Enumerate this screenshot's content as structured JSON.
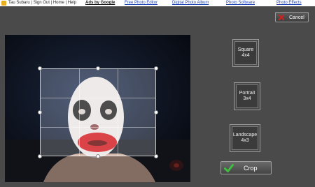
{
  "topbar": {
    "user_links": "Tau Subaru | Sign Out | Home | Help",
    "ads_label": "Ads by Google",
    "links": [
      "Free Photo Editor",
      "Digital Photo Album",
      "Photo Software",
      "Photo Effects"
    ]
  },
  "dialog": {
    "cancel_label": "Cancel",
    "ratios": [
      {
        "name": "Square",
        "dims": "4x4"
      },
      {
        "name": "Portrait",
        "dims": "3x4"
      },
      {
        "name": "Landscape",
        "dims": "4x3"
      }
    ],
    "crop_label": "Crop"
  },
  "colors": {
    "panel_bg": "#4a4a4a",
    "link": "#1a3fb0",
    "cancel_x": "#d02020",
    "crop_check": "#3fbf3f"
  },
  "icons": [
    "app-logo-icon",
    "close-x-icon",
    "checkmark-icon"
  ]
}
